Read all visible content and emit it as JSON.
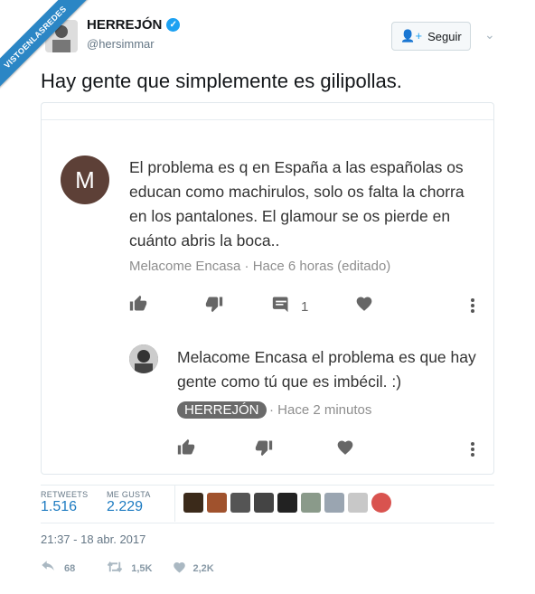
{
  "ribbon": "VISTOENLASREDES",
  "user": {
    "name": "HERREJÓN",
    "handle": "@hersimmar"
  },
  "follow_label": "Seguir",
  "tweet_text": "Hay gente que simplemente es gilipollas.",
  "comment": {
    "initial": "M",
    "text": "El problema es q en España a las españolas os educan como machirulos, solo os falta la chorra en los pantalones.  El glamour se os pierde en cuánto abris la boca..",
    "meta": "Melacome Encasa · Hace 6 horas (editado)",
    "reply_count": "1"
  },
  "reply": {
    "text": "Melacome Encasa el problema es que hay gente como tú que es imbécil. :)",
    "author_badge": "HERREJÓN",
    "meta": "· Hace 2 minutos"
  },
  "stats": {
    "retweets_label": "RETWEETS",
    "retweets": "1.516",
    "likes_label": "ME GUSTA",
    "likes": "2.229"
  },
  "timestamp": "21:37 - 18 abr. 2017",
  "actions": {
    "replies": "68",
    "retweets": "1,5K",
    "likes": "2,2K"
  }
}
